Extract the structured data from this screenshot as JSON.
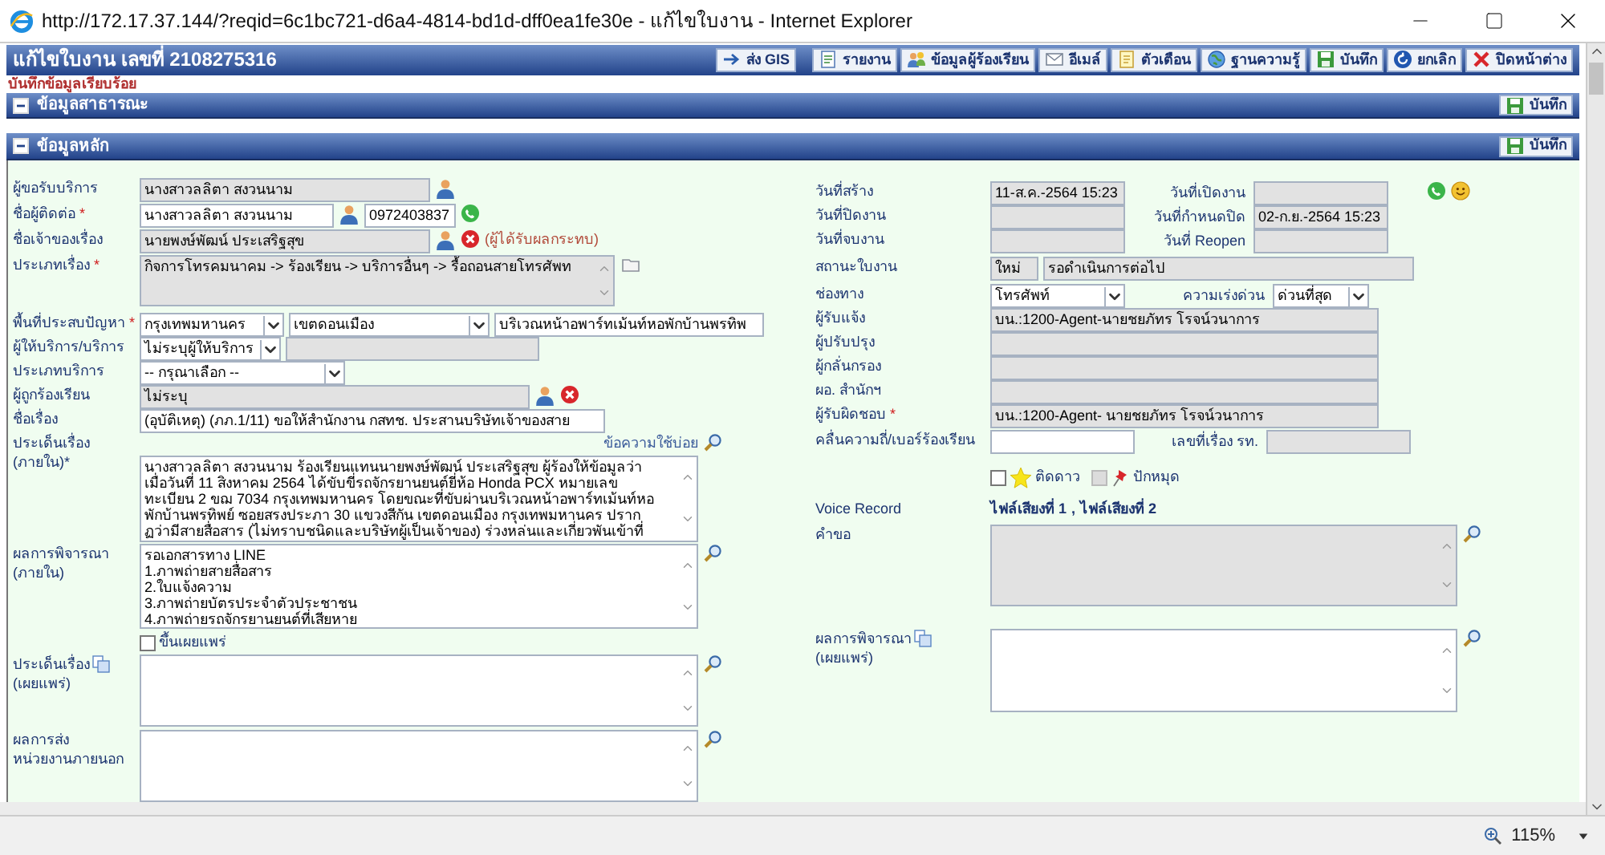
{
  "window": {
    "title": "http://172.17.37.144/?reqid=6c1bc721-d6a4-4814-bd1d-dff0ea1fe30e - แก้ไขใบงาน - Internet Explorer"
  },
  "header": {
    "title": "แก้ไขใบงาน เลขที่ 2108275316",
    "toolbar": [
      "ส่ง GIS",
      "รายงาน",
      "ข้อมูลผู้ร้องเรียน",
      "อีเมล์",
      "ตัวเตือน",
      "ฐานความรู้",
      "บันทึก",
      "ยกเลิก",
      "ปิดหน้าต่าง"
    ]
  },
  "message": "บันทึกข้อมูลเรียบร้อย",
  "sections": [
    {
      "title": "ข้อมูลสาธารณะ",
      "save": "บันทึก"
    },
    {
      "title": "ข้อมูลหลัก",
      "save": "บันทึก"
    }
  ],
  "left_rows": [
    {
      "label": [
        "ผู้ขอรับบริการ"
      ],
      "controls": [
        {
          "kind": "input",
          "value": "นางสาวลลิตา สงวนนาม",
          "disabled": true
        }
      ]
    },
    {
      "label": [
        "ชื่อผู้ติดต่อ"
      ],
      "required_mark": "*",
      "controls": [
        {
          "kind": "input",
          "value": "นางสาวลลิตา สงวนนาม",
          "disabled": false
        },
        {
          "kind": "input",
          "value": "0972403837",
          "disabled": false
        }
      ]
    },
    {
      "label": [
        "ชื่อเจ้าของเรื่อง"
      ],
      "controls": [
        {
          "kind": "input",
          "value": "นายพงษ์พัฒน์ ประเสริฐสุข",
          "disabled": true
        },
        {
          "kind": "note",
          "text": "(ผู้ได้รับผลกระทบ)"
        }
      ]
    },
    {
      "label": [
        "ประเภทเรื่อง"
      ],
      "required_mark": "*",
      "controls": [
        {
          "kind": "textarea",
          "lines": [
            "กิจการโทรคมนาคม -> ร้องเรียน -> บริการอื่นๆ -> รื้อถอนสายโทรศัพท"
          ],
          "disabled": true
        }
      ]
    },
    {
      "label": [
        "พื้นที่ประสบปัญหา"
      ],
      "required_mark": "*",
      "controls": [
        {
          "kind": "select",
          "value": "กรุงเทพมหานคร"
        },
        {
          "kind": "select",
          "value": "เขตดอนเมือง"
        },
        {
          "kind": "input",
          "value": "บริเวณหน้าอพาร์ทเม้นท์หอพักบ้านพรทิพ",
          "disabled": false
        }
      ]
    },
    {
      "label": [
        "ผู้ให้บริการ/บริการ"
      ],
      "controls": [
        {
          "kind": "select",
          "value": "ไม่ระบุผู้ให้บริการ"
        },
        {
          "kind": "input",
          "disabled": true
        }
      ]
    },
    {
      "label": [
        "ประเภทบริการ"
      ],
      "controls": [
        {
          "kind": "select",
          "value": "-- กรุณาเลือก --"
        }
      ]
    },
    {
      "label": [
        "ผู้ถูกร้องเรียน"
      ],
      "controls": [
        {
          "kind": "input",
          "value": "ไม่ระบุ",
          "disabled": true
        }
      ]
    },
    {
      "label": [
        "ชื่อเรื่อง"
      ],
      "controls": [
        {
          "kind": "input",
          "value": "(อุบัติเหตุ) (ภภ.1/11) ขอให้สำนักงาน กสทช. ประสานบริษัทเจ้าของสาย",
          "disabled": false
        }
      ]
    },
    {
      "label": [
        "ประเด็นเรื่อง",
        "(ภายใน)*"
      ],
      "controls": [
        {
          "kind": "link",
          "text": "ข้อความใช้บ่อย"
        },
        {
          "kind": "textarea",
          "disabled": false,
          "lines": [
            "นางสาวลลิตา สงวนนาม ร้องเรียนแทนนายพงษ์พัฒน์ ประเสริฐสุข ผู้ร้องให้ข้อมูลว่า",
            "เมื่อวันที่ 11 สิงหาคม 2564 ได้ขับขี่รถจักรยานยนต์ยี่ห้อ Honda PCX หมายเลข",
            "ทะเบียน 2 ขฌ 7034 กรุงเทพมหานคร โดยขณะที่ขับผ่านบริเวณหน้าอพาร์ทเม้นท์หอ",
            "พักบ้านพรทิพย์ ซอยสรงประภา 30 แขวงสีกัน เขตดอนเมือง กรุงเทพมหานคร ปราก",
            "ฏว่ามีสายสื่อสาร (ไม่ทราบชนิดและบริษัทผู้เป็นเจ้าของ) ร่วงหล่นและเกี่ยวพันเข้าที่"
          ]
        }
      ]
    },
    {
      "label": [
        "ผลการพิจารณา",
        "(ภายใน)"
      ],
      "controls": [
        {
          "kind": "textarea",
          "disabled": false,
          "lines": [
            "รอเอกสารทาง LINE",
            "1.ภาพถ่ายสายสื่อสาร",
            "2.ใบแจ้งความ",
            "3.ภาพถ่ายบัตรประจำตัวประชาชน",
            "4.ภาพถ่ายรถจักรยานยนต์ที่เสียหาย"
          ]
        }
      ]
    },
    {
      "controls": [
        {
          "kind": "checkbox",
          "text": "ขึ้นเผยแพร่",
          "checked": false
        }
      ]
    },
    {
      "label": [
        "ประเด็นเรื่อง",
        "(เผยแพร่)"
      ],
      "controls": [
        {
          "kind": "textarea",
          "disabled": false
        }
      ]
    },
    {
      "label": [
        "ผลการส่ง",
        "หน่วยงานภายนอก"
      ],
      "controls": [
        {
          "kind": "textarea",
          "disabled": false
        }
      ]
    }
  ],
  "right_rows": [
    {
      "label": [
        "วันที่สร้าง"
      ],
      "controls": [
        {
          "kind": "input",
          "value": "11-ส.ค.-2564 15:23",
          "disabled": true
        },
        {
          "kind": "label",
          "text": "วันที่เปิดงาน"
        },
        {
          "kind": "input",
          "disabled": true
        }
      ]
    },
    {
      "label": [
        "วันที่ปิดงาน"
      ],
      "controls": [
        {
          "kind": "input",
          "disabled": true
        },
        {
          "kind": "label",
          "text": "วันที่กำหนดปิด"
        },
        {
          "kind": "input",
          "value": "02-ก.ย.-2564 15:23",
          "disabled": true
        }
      ]
    },
    {
      "label": [
        "วันที่จบงาน"
      ],
      "controls": [
        {
          "kind": "input",
          "disabled": true
        },
        {
          "kind": "label",
          "text": "วันที่ Reopen"
        },
        {
          "kind": "input",
          "disabled": true
        }
      ]
    },
    {
      "label": [
        "สถานะใบงาน"
      ],
      "controls": [
        {
          "kind": "input",
          "value": "ใหม่",
          "disabled": true
        },
        {
          "kind": "input",
          "value": "รอดำเนินการต่อไป",
          "disabled": true
        }
      ]
    },
    {
      "label": [
        "ช่องทาง"
      ],
      "controls": [
        {
          "kind": "select",
          "value": "โทรศัพท์"
        },
        {
          "kind": "label",
          "text": "ความเร่งด่วน"
        },
        {
          "kind": "select",
          "value": "ด่วนที่สุด"
        }
      ]
    },
    {
      "label": [
        "ผู้รับแจ้ง"
      ],
      "controls": [
        {
          "kind": "input",
          "value": "บน.:1200-Agent-นายชยภัทร โรจน์วนาการ",
          "disabled": true
        }
      ]
    },
    {
      "label": [
        "ผู้ปรับปรุง"
      ],
      "controls": [
        {
          "kind": "input",
          "disabled": true
        }
      ]
    },
    {
      "label": [
        "ผู้กลั่นกรอง"
      ],
      "controls": [
        {
          "kind": "input",
          "disabled": true
        }
      ]
    },
    {
      "label": [
        "ผอ. สำนักฯ"
      ],
      "controls": [
        {
          "kind": "input",
          "disabled": true
        }
      ]
    },
    {
      "label": [
        "ผู้รับผิดชอบ"
      ],
      "required_mark": "*",
      "controls": [
        {
          "kind": "input",
          "value": "บน.:1200-Agent- นายชยภัทร โรจน์วนาการ",
          "disabled": true
        }
      ]
    },
    {
      "label": [
        "คลื่นความถี่/เบอร์ร้องเรียน"
      ],
      "controls": [
        {
          "kind": "input",
          "disabled": false
        },
        {
          "kind": "label",
          "text": "เลขที่เรื่อง รท."
        },
        {
          "kind": "input",
          "disabled": true
        }
      ]
    },
    {
      "controls": [
        {
          "kind": "checkbox",
          "text": "ติดดาว",
          "checked": false,
          "disabled": false
        },
        {
          "kind": "checkbox",
          "text": "ปักหมุด",
          "checked": false,
          "disabled": true
        }
      ]
    },
    {
      "label": [
        "Voice Record"
      ],
      "controls": [
        {
          "kind": "links",
          "items": [
            "ไฟล์เสียงที่ 1",
            "ไฟล์เสียงที่ 2"
          ],
          "separator": ","
        }
      ]
    },
    {
      "label": [
        "คำขอ"
      ],
      "controls": [
        {
          "kind": "textarea",
          "disabled": true
        }
      ]
    },
    {
      "label": [
        "ผลการพิจารณา",
        "(เผยแพร่)"
      ],
      "controls": [
        {
          "kind": "textarea",
          "disabled": false
        }
      ]
    }
  ],
  "status_bar": {
    "zoom": "115%"
  }
}
